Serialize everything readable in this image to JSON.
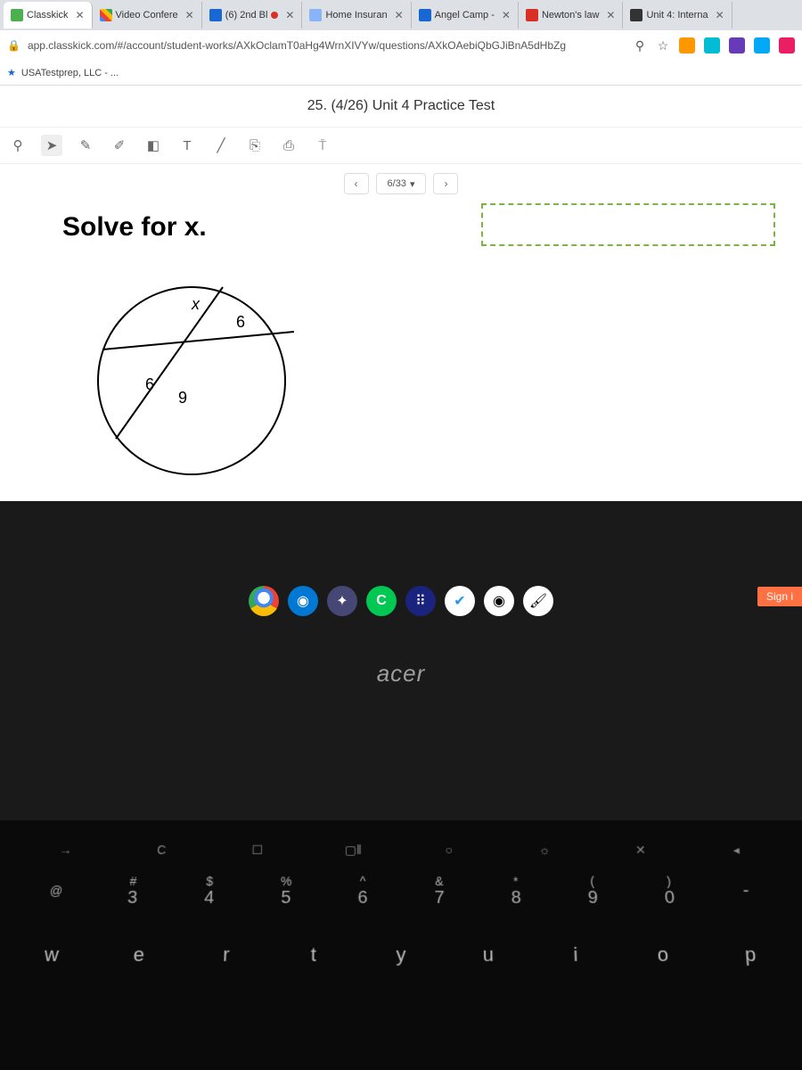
{
  "tabs": [
    {
      "label": "Classkick",
      "favicon": "fav-green",
      "active": true
    },
    {
      "label": "Video Confere",
      "favicon": "fav-multi"
    },
    {
      "label": "(6) 2nd Bl",
      "favicon": "fav-blue",
      "audio": true
    },
    {
      "label": "Home Insuran",
      "favicon": "fav-insur"
    },
    {
      "label": "Angel Camp -",
      "favicon": "fav-blue"
    },
    {
      "label": "Newton's law",
      "favicon": "fav-red"
    },
    {
      "label": "Unit 4: Interna",
      "favicon": "fav-x"
    }
  ],
  "url": "app.classkick.com/#/account/student-works/AXkOclamT0aHg4WrnXIVYw/questions/AXkOAebiQbGJiBnA5dHbZg",
  "bookmark": {
    "label": "USATestprep, LLC - ..."
  },
  "header": {
    "title": "25. (4/26) Unit 4 Practice Test"
  },
  "nav": {
    "page": "6/33"
  },
  "question": {
    "title": "Solve for x."
  },
  "diagram": {
    "x_label": "x",
    "val_6a": "6",
    "val_6b": "6",
    "val_9": "9"
  },
  "taskbar": {
    "sign": "Sign i"
  },
  "brand": "acer",
  "keyboard": {
    "fn_row": [
      {
        "icon": "→"
      },
      {
        "icon": "C"
      },
      {
        "icon": "☐"
      },
      {
        "icon": "▢‖"
      },
      {
        "icon": "○"
      },
      {
        "icon": "☼"
      },
      {
        "icon": "✕"
      },
      {
        "icon": "◂"
      }
    ],
    "num_row": [
      {
        "sym": "@",
        "num": ""
      },
      {
        "sym": "#",
        "num": "3"
      },
      {
        "sym": "$",
        "num": "4"
      },
      {
        "sym": "%",
        "num": "5"
      },
      {
        "sym": "^",
        "num": "6"
      },
      {
        "sym": "&",
        "num": "7"
      },
      {
        "sym": "*",
        "num": "8"
      },
      {
        "sym": "(",
        "num": "9"
      },
      {
        "sym": ")",
        "num": "0"
      },
      {
        "sym": "",
        "num": "-"
      }
    ],
    "letter_row": [
      "w",
      "e",
      "r",
      "t",
      "y",
      "u",
      "i",
      "o",
      "p"
    ]
  }
}
